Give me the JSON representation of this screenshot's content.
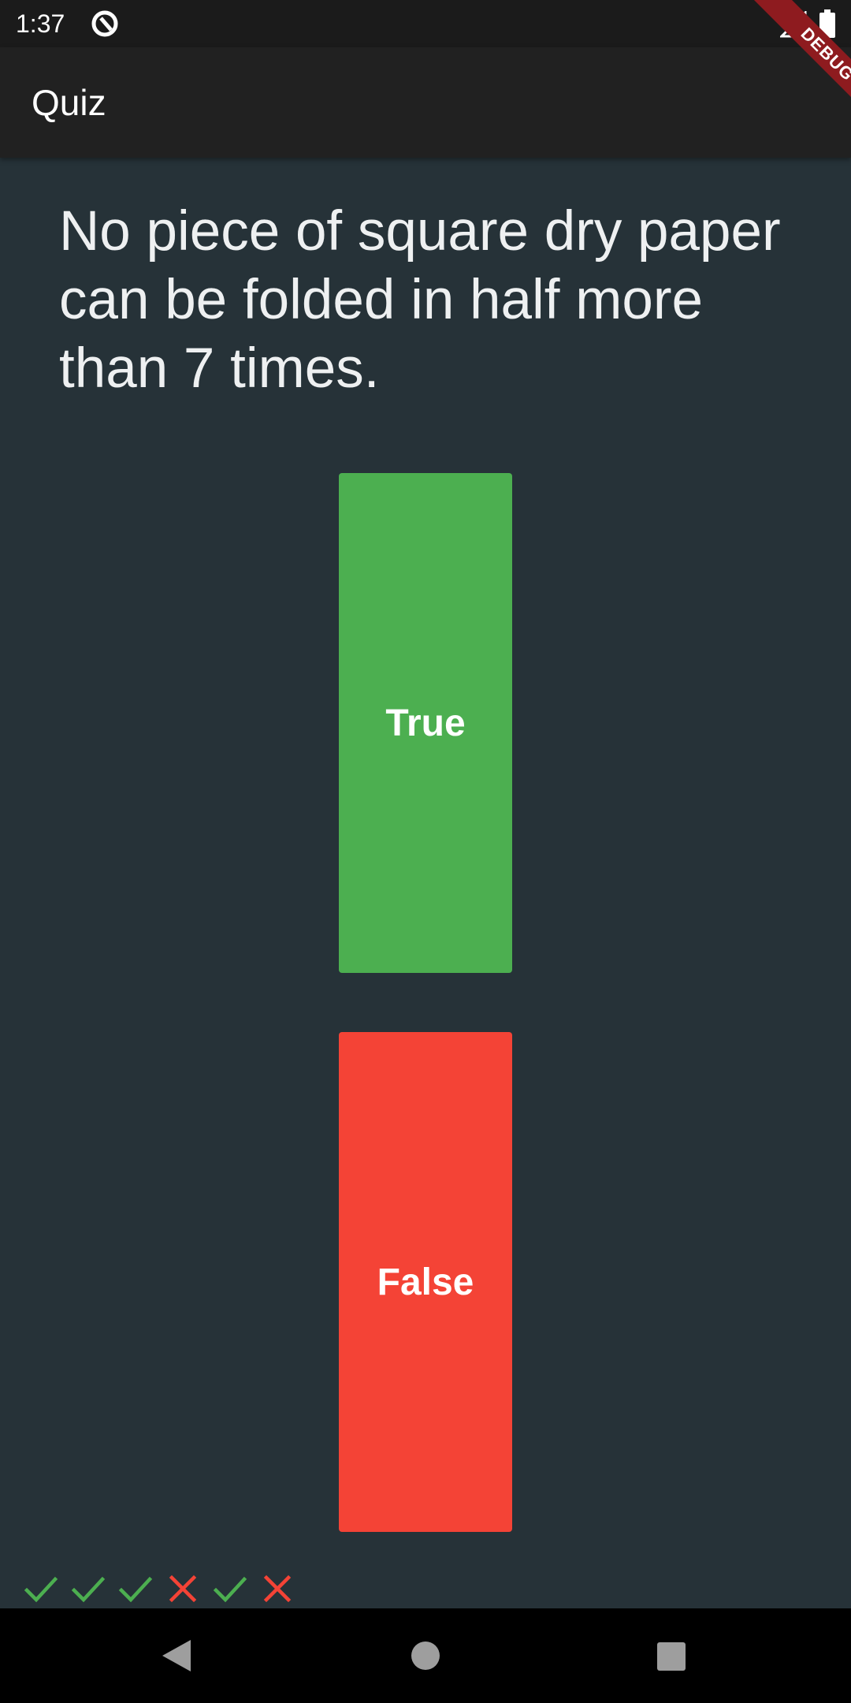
{
  "status_bar": {
    "time": "1:37",
    "app_icon": "at-sign-icon",
    "signal_icon": "signal-icon",
    "battery_icon": "battery-icon"
  },
  "app_bar": {
    "title": "Quiz",
    "debug_banner": "DEBUG"
  },
  "question": {
    "text": "No piece of square dry paper can be folded in half more than 7 times."
  },
  "answers": {
    "true_label": "True",
    "false_label": "False",
    "true_color": "#4caf50",
    "false_color": "#f44336"
  },
  "score_keeper": [
    {
      "result": "correct",
      "icon": "check-icon",
      "color": "#4caf50"
    },
    {
      "result": "correct",
      "icon": "check-icon",
      "color": "#4caf50"
    },
    {
      "result": "correct",
      "icon": "check-icon",
      "color": "#4caf50"
    },
    {
      "result": "wrong",
      "icon": "close-icon",
      "color": "#f44336"
    },
    {
      "result": "correct",
      "icon": "check-icon",
      "color": "#4caf50"
    },
    {
      "result": "wrong",
      "icon": "close-icon",
      "color": "#f44336"
    }
  ],
  "navigation_bar": {
    "back_icon": "back-triangle-icon",
    "home_icon": "home-circle-icon",
    "recents_icon": "recents-square-icon"
  }
}
